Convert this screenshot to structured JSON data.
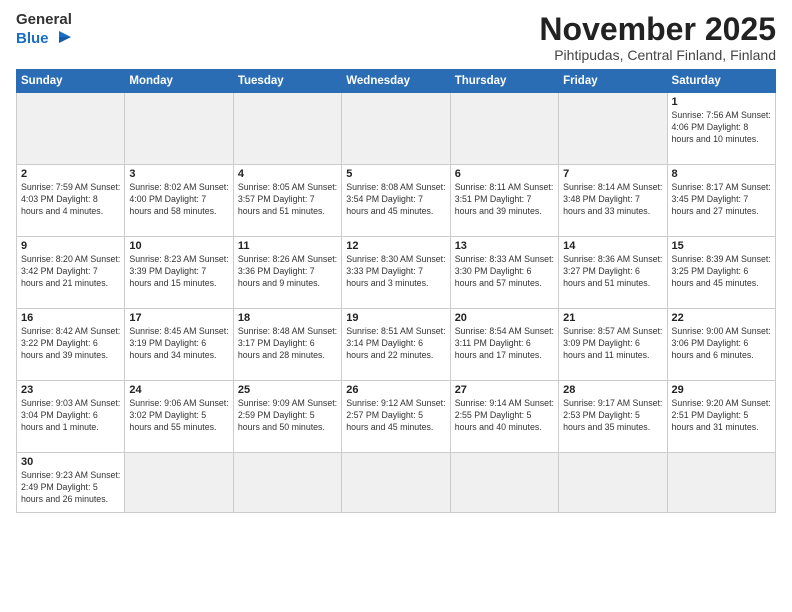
{
  "header": {
    "logo_general": "General",
    "logo_blue": "Blue",
    "title": "November 2025",
    "subtitle": "Pihtipudas, Central Finland, Finland"
  },
  "weekdays": [
    "Sunday",
    "Monday",
    "Tuesday",
    "Wednesday",
    "Thursday",
    "Friday",
    "Saturday"
  ],
  "weeks": [
    [
      {
        "day": "",
        "info": ""
      },
      {
        "day": "",
        "info": ""
      },
      {
        "day": "",
        "info": ""
      },
      {
        "day": "",
        "info": ""
      },
      {
        "day": "",
        "info": ""
      },
      {
        "day": "",
        "info": ""
      },
      {
        "day": "1",
        "info": "Sunrise: 7:56 AM\nSunset: 4:06 PM\nDaylight: 8 hours\nand 10 minutes."
      }
    ],
    [
      {
        "day": "2",
        "info": "Sunrise: 7:59 AM\nSunset: 4:03 PM\nDaylight: 8 hours\nand 4 minutes."
      },
      {
        "day": "3",
        "info": "Sunrise: 8:02 AM\nSunset: 4:00 PM\nDaylight: 7 hours\nand 58 minutes."
      },
      {
        "day": "4",
        "info": "Sunrise: 8:05 AM\nSunset: 3:57 PM\nDaylight: 7 hours\nand 51 minutes."
      },
      {
        "day": "5",
        "info": "Sunrise: 8:08 AM\nSunset: 3:54 PM\nDaylight: 7 hours\nand 45 minutes."
      },
      {
        "day": "6",
        "info": "Sunrise: 8:11 AM\nSunset: 3:51 PM\nDaylight: 7 hours\nand 39 minutes."
      },
      {
        "day": "7",
        "info": "Sunrise: 8:14 AM\nSunset: 3:48 PM\nDaylight: 7 hours\nand 33 minutes."
      },
      {
        "day": "8",
        "info": "Sunrise: 8:17 AM\nSunset: 3:45 PM\nDaylight: 7 hours\nand 27 minutes."
      }
    ],
    [
      {
        "day": "9",
        "info": "Sunrise: 8:20 AM\nSunset: 3:42 PM\nDaylight: 7 hours\nand 21 minutes."
      },
      {
        "day": "10",
        "info": "Sunrise: 8:23 AM\nSunset: 3:39 PM\nDaylight: 7 hours\nand 15 minutes."
      },
      {
        "day": "11",
        "info": "Sunrise: 8:26 AM\nSunset: 3:36 PM\nDaylight: 7 hours\nand 9 minutes."
      },
      {
        "day": "12",
        "info": "Sunrise: 8:30 AM\nSunset: 3:33 PM\nDaylight: 7 hours\nand 3 minutes."
      },
      {
        "day": "13",
        "info": "Sunrise: 8:33 AM\nSunset: 3:30 PM\nDaylight: 6 hours\nand 57 minutes."
      },
      {
        "day": "14",
        "info": "Sunrise: 8:36 AM\nSunset: 3:27 PM\nDaylight: 6 hours\nand 51 minutes."
      },
      {
        "day": "15",
        "info": "Sunrise: 8:39 AM\nSunset: 3:25 PM\nDaylight: 6 hours\nand 45 minutes."
      }
    ],
    [
      {
        "day": "16",
        "info": "Sunrise: 8:42 AM\nSunset: 3:22 PM\nDaylight: 6 hours\nand 39 minutes."
      },
      {
        "day": "17",
        "info": "Sunrise: 8:45 AM\nSunset: 3:19 PM\nDaylight: 6 hours\nand 34 minutes."
      },
      {
        "day": "18",
        "info": "Sunrise: 8:48 AM\nSunset: 3:17 PM\nDaylight: 6 hours\nand 28 minutes."
      },
      {
        "day": "19",
        "info": "Sunrise: 8:51 AM\nSunset: 3:14 PM\nDaylight: 6 hours\nand 22 minutes."
      },
      {
        "day": "20",
        "info": "Sunrise: 8:54 AM\nSunset: 3:11 PM\nDaylight: 6 hours\nand 17 minutes."
      },
      {
        "day": "21",
        "info": "Sunrise: 8:57 AM\nSunset: 3:09 PM\nDaylight: 6 hours\nand 11 minutes."
      },
      {
        "day": "22",
        "info": "Sunrise: 9:00 AM\nSunset: 3:06 PM\nDaylight: 6 hours\nand 6 minutes."
      }
    ],
    [
      {
        "day": "23",
        "info": "Sunrise: 9:03 AM\nSunset: 3:04 PM\nDaylight: 6 hours\nand 1 minute."
      },
      {
        "day": "24",
        "info": "Sunrise: 9:06 AM\nSunset: 3:02 PM\nDaylight: 5 hours\nand 55 minutes."
      },
      {
        "day": "25",
        "info": "Sunrise: 9:09 AM\nSunset: 2:59 PM\nDaylight: 5 hours\nand 50 minutes."
      },
      {
        "day": "26",
        "info": "Sunrise: 9:12 AM\nSunset: 2:57 PM\nDaylight: 5 hours\nand 45 minutes."
      },
      {
        "day": "27",
        "info": "Sunrise: 9:14 AM\nSunset: 2:55 PM\nDaylight: 5 hours\nand 40 minutes."
      },
      {
        "day": "28",
        "info": "Sunrise: 9:17 AM\nSunset: 2:53 PM\nDaylight: 5 hours\nand 35 minutes."
      },
      {
        "day": "29",
        "info": "Sunrise: 9:20 AM\nSunset: 2:51 PM\nDaylight: 5 hours\nand 31 minutes."
      }
    ],
    [
      {
        "day": "30",
        "info": "Sunrise: 9:23 AM\nSunset: 2:49 PM\nDaylight: 5 hours\nand 26 minutes."
      },
      {
        "day": "",
        "info": ""
      },
      {
        "day": "",
        "info": ""
      },
      {
        "day": "",
        "info": ""
      },
      {
        "day": "",
        "info": ""
      },
      {
        "day": "",
        "info": ""
      },
      {
        "day": "",
        "info": ""
      }
    ]
  ]
}
